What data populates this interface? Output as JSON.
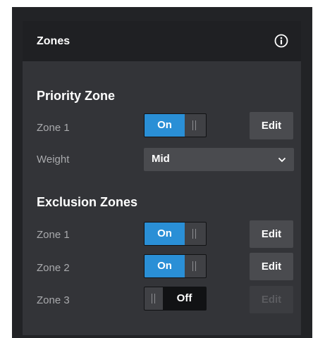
{
  "panel": {
    "title": "Zones",
    "info_icon": "info-icon"
  },
  "priority_zone": {
    "title": "Priority Zone",
    "zone_label": "Zone 1",
    "toggle_state": "On",
    "edit_label": "Edit",
    "weight_label": "Weight",
    "weight_value": "Mid"
  },
  "exclusion_zones": {
    "title": "Exclusion Zones",
    "zones": [
      {
        "label": "Zone 1",
        "state": "On",
        "edit_label": "Edit",
        "edit_enabled": true
      },
      {
        "label": "Zone 2",
        "state": "On",
        "edit_label": "Edit",
        "edit_enabled": true
      },
      {
        "label": "Zone 3",
        "state": "Off",
        "edit_label": "Edit",
        "edit_enabled": false
      }
    ]
  },
  "colors": {
    "accent_on": "#2a8fd6",
    "panel_bg": "#333438",
    "header_bg": "#1f2023"
  }
}
